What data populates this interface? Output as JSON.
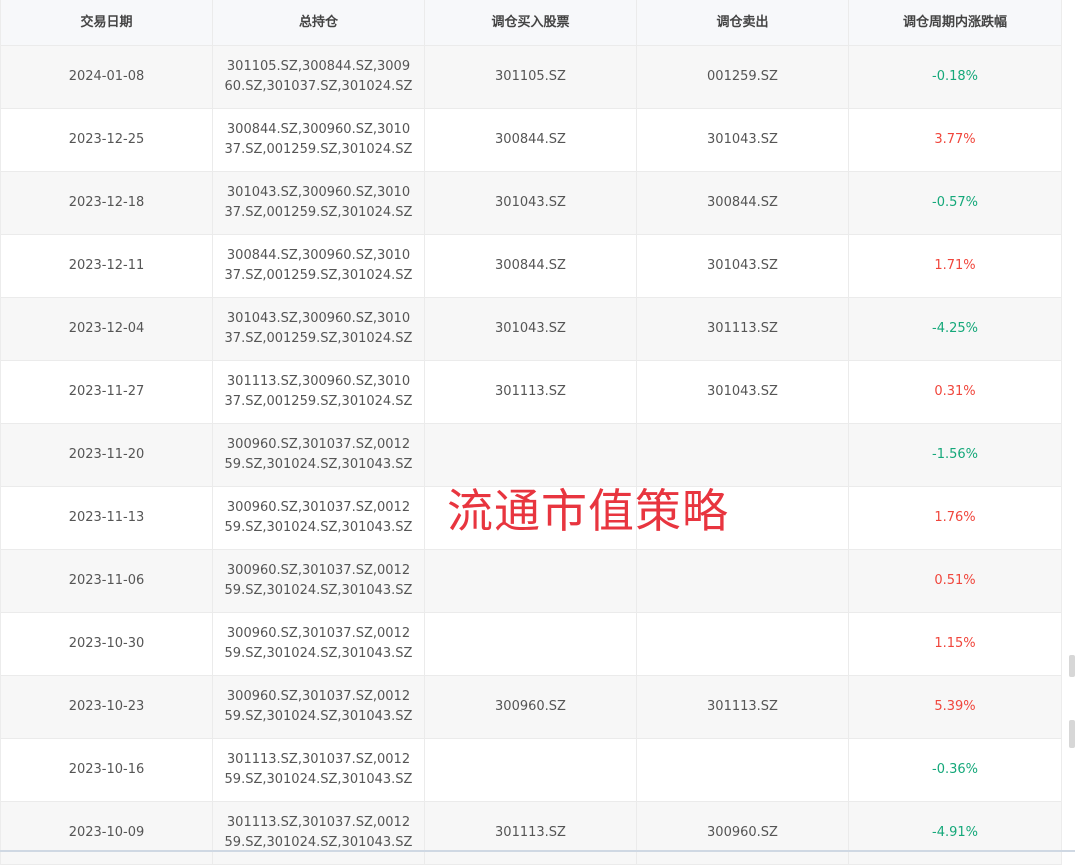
{
  "table": {
    "headers": [
      "交易日期",
      "总持仓",
      "调仓买入股票",
      "调仓卖出",
      "调仓周期内涨跌幅"
    ],
    "rows": [
      {
        "date": "2024-01-08",
        "holdings": "301105.SZ,300844.SZ,300960.SZ,301037.SZ,301024.SZ",
        "buy": "301105.SZ",
        "sell": "001259.SZ",
        "change": "-0.18%"
      },
      {
        "date": "2023-12-25",
        "holdings": "300844.SZ,300960.SZ,301037.SZ,001259.SZ,301024.SZ",
        "buy": "300844.SZ",
        "sell": "301043.SZ",
        "change": "3.77%"
      },
      {
        "date": "2023-12-18",
        "holdings": "301043.SZ,300960.SZ,301037.SZ,001259.SZ,301024.SZ",
        "buy": "301043.SZ",
        "sell": "300844.SZ",
        "change": "-0.57%"
      },
      {
        "date": "2023-12-11",
        "holdings": "300844.SZ,300960.SZ,301037.SZ,001259.SZ,301024.SZ",
        "buy": "300844.SZ",
        "sell": "301043.SZ",
        "change": "1.71%"
      },
      {
        "date": "2023-12-04",
        "holdings": "301043.SZ,300960.SZ,301037.SZ,001259.SZ,301024.SZ",
        "buy": "301043.SZ",
        "sell": "301113.SZ",
        "change": "-4.25%"
      },
      {
        "date": "2023-11-27",
        "holdings": "301113.SZ,300960.SZ,301037.SZ,001259.SZ,301024.SZ",
        "buy": "301113.SZ",
        "sell": "301043.SZ",
        "change": "0.31%"
      },
      {
        "date": "2023-11-20",
        "holdings": "300960.SZ,301037.SZ,001259.SZ,301024.SZ,301043.SZ",
        "buy": "",
        "sell": "",
        "change": "-1.56%"
      },
      {
        "date": "2023-11-13",
        "holdings": "300960.SZ,301037.SZ,001259.SZ,301024.SZ,301043.SZ",
        "buy": "",
        "sell": "",
        "change": "1.76%"
      },
      {
        "date": "2023-11-06",
        "holdings": "300960.SZ,301037.SZ,001259.SZ,301024.SZ,301043.SZ",
        "buy": "",
        "sell": "",
        "change": "0.51%"
      },
      {
        "date": "2023-10-30",
        "holdings": "300960.SZ,301037.SZ,001259.SZ,301024.SZ,301043.SZ",
        "buy": "",
        "sell": "",
        "change": "1.15%"
      },
      {
        "date": "2023-10-23",
        "holdings": "300960.SZ,301037.SZ,001259.SZ,301024.SZ,301043.SZ",
        "buy": "300960.SZ",
        "sell": "301113.SZ",
        "change": "5.39%"
      },
      {
        "date": "2023-10-16",
        "holdings": "301113.SZ,301037.SZ,001259.SZ,301024.SZ,301043.SZ",
        "buy": "",
        "sell": "",
        "change": "-0.36%"
      },
      {
        "date": "2023-10-09",
        "holdings": "301113.SZ,301037.SZ,001259.SZ,301024.SZ,301043.SZ",
        "buy": "301113.SZ",
        "sell": "300960.SZ",
        "change": "-4.91%"
      }
    ]
  },
  "watermark": "流通市值策略",
  "colors": {
    "positive": "#f0463c",
    "negative": "#15a87a"
  }
}
